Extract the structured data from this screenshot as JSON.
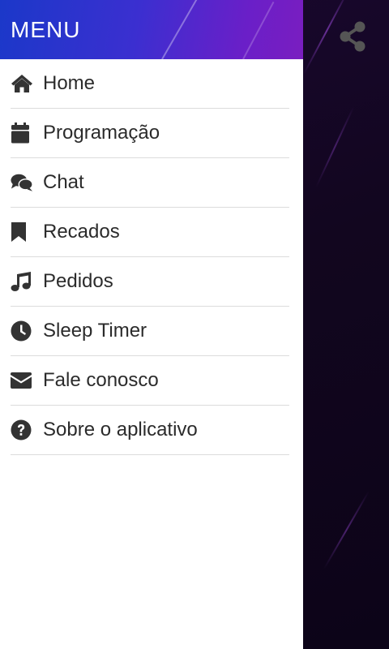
{
  "drawer": {
    "title": "MENU",
    "items": [
      {
        "label": "Home",
        "icon": "home-icon"
      },
      {
        "label": "Programação",
        "icon": "calendar-icon"
      },
      {
        "label": "Chat",
        "icon": "chat-icon"
      },
      {
        "label": "Recados",
        "icon": "bookmark-icon"
      },
      {
        "label": "Pedidos",
        "icon": "music-note-icon"
      },
      {
        "label": "Sleep Timer",
        "icon": "clock-icon"
      },
      {
        "label": "Fale conosco",
        "icon": "envelope-icon"
      },
      {
        "label": "Sobre o aplicativo",
        "icon": "question-circle-icon"
      }
    ]
  },
  "share": {
    "icon": "share-icon"
  },
  "colors": {
    "header_gradient_start": "#1b38c9",
    "header_gradient_end": "#7a1ec0",
    "background": "#12061f",
    "text": "#2b2b2b",
    "icon": "#333333",
    "share_icon": "#555555",
    "divider": "#dcdcdc"
  }
}
